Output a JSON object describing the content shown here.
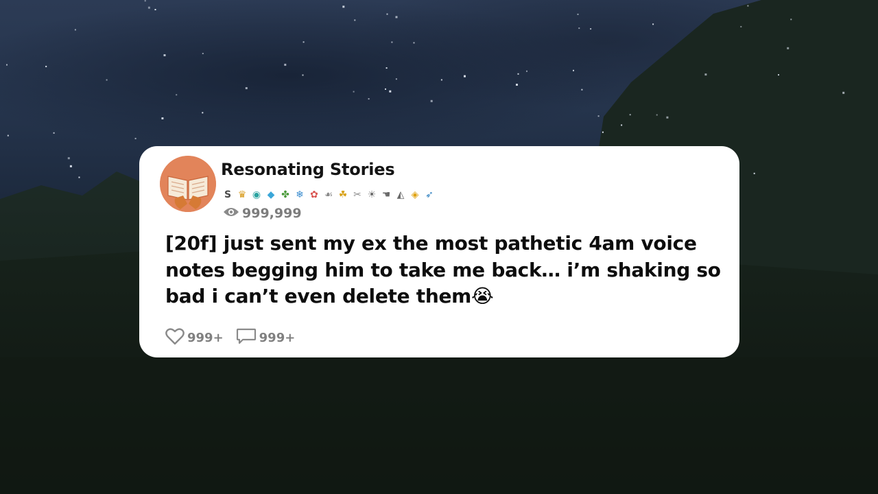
{
  "post": {
    "channel_name": "Resonating Stories",
    "views": "999,999",
    "text": "[20f] just sent my ex the most pathetic 4am voice notes begging him to take me back… i’m shaking so bad i can’t even delete them😭",
    "likes": "999+",
    "comments": "999+"
  },
  "avatar_icon": "open-book-hands-icon",
  "badges": [
    {
      "icon": "s-coin-icon",
      "glyph": "S",
      "color": "#4a4a4a"
    },
    {
      "icon": "crown-badge-icon",
      "glyph": "♛",
      "color": "#d89b1c"
    },
    {
      "icon": "teal-medal-icon",
      "glyph": "◉",
      "color": "#2aa3a0"
    },
    {
      "icon": "diamond-icon",
      "glyph": "◆",
      "color": "#3aa6d8"
    },
    {
      "icon": "clover-icon",
      "glyph": "✤",
      "color": "#4a9a3a"
    },
    {
      "icon": "snowflake-icon",
      "glyph": "❄",
      "color": "#3a8ccf"
    },
    {
      "icon": "flower-rocket-icon",
      "glyph": "✿",
      "color": "#d9534f"
    },
    {
      "icon": "praying-hands-icon",
      "glyph": "☙",
      "color": "#8a8a8a"
    },
    {
      "icon": "clapping-hands-icon",
      "glyph": "☘",
      "color": "#d8a21c"
    },
    {
      "icon": "bone-icon",
      "glyph": "✂",
      "color": "#8a8a8a"
    },
    {
      "icon": "sprout-icon",
      "glyph": "☀",
      "color": "#6a6a6a"
    },
    {
      "icon": "hand-icon",
      "glyph": "☚",
      "color": "#6a6a6a"
    },
    {
      "icon": "cone-icon",
      "glyph": "◭",
      "color": "#6a6a6a"
    },
    {
      "icon": "wrapped-candy-icon",
      "glyph": "◈",
      "color": "#e0a20f"
    },
    {
      "icon": "rocket-icon",
      "glyph": "➶",
      "color": "#2c7fbf"
    }
  ],
  "colors": {
    "card_background": "#ffffff",
    "avatar_background": "#e2845a",
    "text_primary": "#0d0d0d",
    "text_muted": "#808080"
  }
}
